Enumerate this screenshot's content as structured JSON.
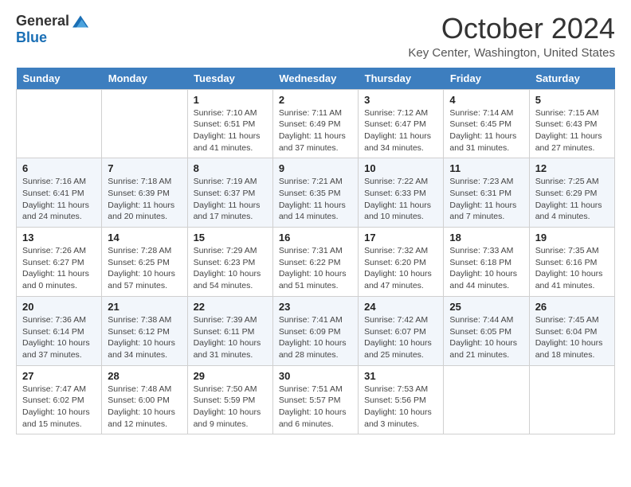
{
  "logo": {
    "general": "General",
    "blue": "Blue"
  },
  "title": "October 2024",
  "location": "Key Center, Washington, United States",
  "days_of_week": [
    "Sunday",
    "Monday",
    "Tuesday",
    "Wednesday",
    "Thursday",
    "Friday",
    "Saturday"
  ],
  "weeks": [
    [
      {
        "day": "",
        "info": ""
      },
      {
        "day": "",
        "info": ""
      },
      {
        "day": "1",
        "info": "Sunrise: 7:10 AM\nSunset: 6:51 PM\nDaylight: 11 hours and 41 minutes."
      },
      {
        "day": "2",
        "info": "Sunrise: 7:11 AM\nSunset: 6:49 PM\nDaylight: 11 hours and 37 minutes."
      },
      {
        "day": "3",
        "info": "Sunrise: 7:12 AM\nSunset: 6:47 PM\nDaylight: 11 hours and 34 minutes."
      },
      {
        "day": "4",
        "info": "Sunrise: 7:14 AM\nSunset: 6:45 PM\nDaylight: 11 hours and 31 minutes."
      },
      {
        "day": "5",
        "info": "Sunrise: 7:15 AM\nSunset: 6:43 PM\nDaylight: 11 hours and 27 minutes."
      }
    ],
    [
      {
        "day": "6",
        "info": "Sunrise: 7:16 AM\nSunset: 6:41 PM\nDaylight: 11 hours and 24 minutes."
      },
      {
        "day": "7",
        "info": "Sunrise: 7:18 AM\nSunset: 6:39 PM\nDaylight: 11 hours and 20 minutes."
      },
      {
        "day": "8",
        "info": "Sunrise: 7:19 AM\nSunset: 6:37 PM\nDaylight: 11 hours and 17 minutes."
      },
      {
        "day": "9",
        "info": "Sunrise: 7:21 AM\nSunset: 6:35 PM\nDaylight: 11 hours and 14 minutes."
      },
      {
        "day": "10",
        "info": "Sunrise: 7:22 AM\nSunset: 6:33 PM\nDaylight: 11 hours and 10 minutes."
      },
      {
        "day": "11",
        "info": "Sunrise: 7:23 AM\nSunset: 6:31 PM\nDaylight: 11 hours and 7 minutes."
      },
      {
        "day": "12",
        "info": "Sunrise: 7:25 AM\nSunset: 6:29 PM\nDaylight: 11 hours and 4 minutes."
      }
    ],
    [
      {
        "day": "13",
        "info": "Sunrise: 7:26 AM\nSunset: 6:27 PM\nDaylight: 11 hours and 0 minutes."
      },
      {
        "day": "14",
        "info": "Sunrise: 7:28 AM\nSunset: 6:25 PM\nDaylight: 10 hours and 57 minutes."
      },
      {
        "day": "15",
        "info": "Sunrise: 7:29 AM\nSunset: 6:23 PM\nDaylight: 10 hours and 54 minutes."
      },
      {
        "day": "16",
        "info": "Sunrise: 7:31 AM\nSunset: 6:22 PM\nDaylight: 10 hours and 51 minutes."
      },
      {
        "day": "17",
        "info": "Sunrise: 7:32 AM\nSunset: 6:20 PM\nDaylight: 10 hours and 47 minutes."
      },
      {
        "day": "18",
        "info": "Sunrise: 7:33 AM\nSunset: 6:18 PM\nDaylight: 10 hours and 44 minutes."
      },
      {
        "day": "19",
        "info": "Sunrise: 7:35 AM\nSunset: 6:16 PM\nDaylight: 10 hours and 41 minutes."
      }
    ],
    [
      {
        "day": "20",
        "info": "Sunrise: 7:36 AM\nSunset: 6:14 PM\nDaylight: 10 hours and 37 minutes."
      },
      {
        "day": "21",
        "info": "Sunrise: 7:38 AM\nSunset: 6:12 PM\nDaylight: 10 hours and 34 minutes."
      },
      {
        "day": "22",
        "info": "Sunrise: 7:39 AM\nSunset: 6:11 PM\nDaylight: 10 hours and 31 minutes."
      },
      {
        "day": "23",
        "info": "Sunrise: 7:41 AM\nSunset: 6:09 PM\nDaylight: 10 hours and 28 minutes."
      },
      {
        "day": "24",
        "info": "Sunrise: 7:42 AM\nSunset: 6:07 PM\nDaylight: 10 hours and 25 minutes."
      },
      {
        "day": "25",
        "info": "Sunrise: 7:44 AM\nSunset: 6:05 PM\nDaylight: 10 hours and 21 minutes."
      },
      {
        "day": "26",
        "info": "Sunrise: 7:45 AM\nSunset: 6:04 PM\nDaylight: 10 hours and 18 minutes."
      }
    ],
    [
      {
        "day": "27",
        "info": "Sunrise: 7:47 AM\nSunset: 6:02 PM\nDaylight: 10 hours and 15 minutes."
      },
      {
        "day": "28",
        "info": "Sunrise: 7:48 AM\nSunset: 6:00 PM\nDaylight: 10 hours and 12 minutes."
      },
      {
        "day": "29",
        "info": "Sunrise: 7:50 AM\nSunset: 5:59 PM\nDaylight: 10 hours and 9 minutes."
      },
      {
        "day": "30",
        "info": "Sunrise: 7:51 AM\nSunset: 5:57 PM\nDaylight: 10 hours and 6 minutes."
      },
      {
        "day": "31",
        "info": "Sunrise: 7:53 AM\nSunset: 5:56 PM\nDaylight: 10 hours and 3 minutes."
      },
      {
        "day": "",
        "info": ""
      },
      {
        "day": "",
        "info": ""
      }
    ]
  ]
}
